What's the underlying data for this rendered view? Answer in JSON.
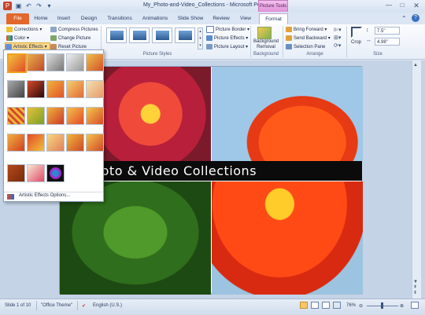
{
  "window": {
    "title": "My_Photo-and-Video_Collections - Microsoft PowerPoint",
    "context_tab_group": "Picture Tools",
    "controls": [
      "minimize-icon",
      "maximize-icon",
      "close-icon"
    ]
  },
  "tabs": [
    "File",
    "Home",
    "Insert",
    "Design",
    "Transitions",
    "Animations",
    "Slide Show",
    "Review",
    "View",
    "Format"
  ],
  "ribbon": {
    "adjust": {
      "corrections": "Corrections ▾",
      "color": "Color ▾",
      "artistic_effects": "Artistic Effects ▾",
      "compress": "Compress Pictures",
      "change": "Change Picture",
      "reset": "Reset Picture"
    },
    "picture_styles": {
      "label": "Picture Styles",
      "border": "Picture Border ▾",
      "effects": "Picture Effects ▾",
      "layout": "Picture Layout ▾"
    },
    "background": {
      "button": "Background Removal",
      "label": "Background"
    },
    "arrange": {
      "bring_forward": "Bring Forward ▾",
      "send_backward": "Send Backward ▾",
      "selection_pane": "Selection Pane",
      "label": "Arrange"
    },
    "size": {
      "crop": "Crop",
      "height": "7.5\"",
      "width": "4.98\"",
      "label": "Size"
    }
  },
  "slide": {
    "banner_text": "hoto & Video Collections"
  },
  "dropdown": {
    "footer": "Artistic Effects Options..."
  },
  "status": {
    "slide": "Slide 1 of 10",
    "theme": "\"Office Theme\"",
    "language": "English (U.S.)",
    "zoom": "76%"
  },
  "colors": {
    "file_tab": "#e2672d",
    "picture_tools": "#e092d8",
    "ribbon_bg": "#fbfcfe",
    "editor_bg": "#c4d3e6"
  }
}
